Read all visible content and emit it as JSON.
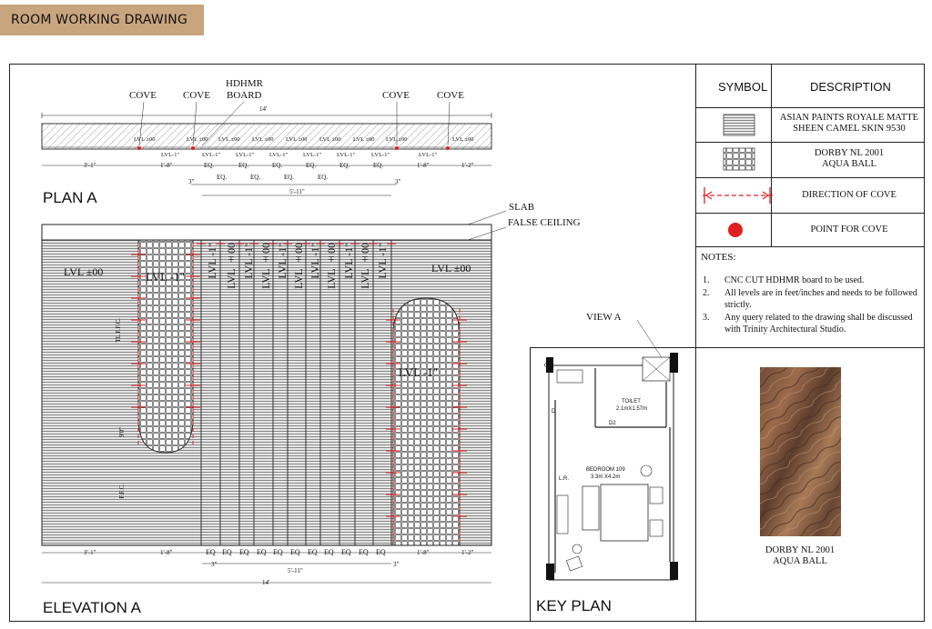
{
  "header": {
    "title": "ROOM WORKING DRAWING"
  },
  "plan": {
    "title": "PLAN A",
    "labels": {
      "cove": "COVE",
      "hdhmr_line1": "HDHMR",
      "hdhmr_line2": "BOARD"
    },
    "top_dim": "14'",
    "levels_top": [
      "LVL ±00",
      "LVL ±00",
      "LVL ±00",
      "LVL ±00",
      "LVL ±00",
      "LVL ±00",
      "LVL ±00",
      "LVL ±00",
      "LVL ±00"
    ],
    "levels_bottom": [
      "LVL-1\"",
      "LVL-1\"",
      "LVL-1\"",
      "LVL-1\"",
      "LVL-1\"",
      "LVL-1\"",
      "LVL-1\""
    ],
    "dims": [
      "3'-1\"",
      "1'-8\"",
      "EQ.",
      "EQ.",
      "EQ.",
      "EQ.",
      "EQ.",
      "EQ.",
      "1'-8\"",
      "1'-2\""
    ],
    "sub_dims": [
      "3\"",
      "EQ.",
      "EQ.",
      "EQ.",
      "EQ.",
      "3\""
    ],
    "span_dim": "5'-11\""
  },
  "elevation": {
    "title": "ELEVATION A",
    "slab": "SLAB",
    "false_ceiling": "FALSE CEILING",
    "lvl_left": "LVL ±00",
    "lvl_right": "LVL ±00",
    "lvl_pocket_left": "LVL -1\"",
    "lvl_pocket_right": "LVL -1\"",
    "strip_labels": [
      "LVL -1\"",
      "LVL ±00",
      "LVL -1\"",
      "LVL ±00",
      "LVL -1\"",
      "LVL ±00",
      "LVL -1\"",
      "LVL ±00",
      "LVL -1\"",
      "LVL ±00",
      "LVL -1\""
    ],
    "side_marks": [
      "TL F.F.C.",
      "9'0\"",
      "F.F.C."
    ],
    "dims": [
      "3'-1\"",
      "1'-8\"",
      "EQ",
      "EQ",
      "EQ",
      "EQ",
      "EQ",
      "EQ",
      "EQ",
      "EQ",
      "EQ",
      "EQ",
      "EQ",
      "1'-8\"",
      "1'-2\""
    ],
    "sub_dims": [
      "3\"",
      "5'-11\"",
      "3\""
    ],
    "total_dim": "14'"
  },
  "legend": {
    "symbol_header": "SYMBOL",
    "description_header": "DESCRIPTION",
    "rows": [
      {
        "symbol": "horizontal-hatch-swatch",
        "description_line1": "ASIAN PAINTS ROYALE MATTE",
        "description_line2": "SHEEN CAMEL SKIN 9530"
      },
      {
        "symbol": "grid-tile-swatch",
        "description_line1": "DORBY NL 2001",
        "description_line2": "AQUA BALL"
      },
      {
        "symbol": "direction-of-cove-arrow",
        "description_line1": "DIRECTION OF COVE",
        "description_line2": ""
      },
      {
        "symbol": "red-dot",
        "description_line1": "POINT FOR COVE",
        "description_line2": ""
      }
    ],
    "colors": {
      "cove_red": "#e02020",
      "sample_brown": "#8a5a3a"
    }
  },
  "notes": {
    "title": "NOTES:",
    "items": [
      {
        "num": "1.",
        "text": "CNC CUT HDHMR board to be used."
      },
      {
        "num": "2.",
        "text": "All levels are in feet/inches and needs to be followed strictly."
      },
      {
        "num": "3.",
        "text": "Any query related to the drawing shall be discussed with Trinity Architectural Studio."
      }
    ]
  },
  "key_plan": {
    "title": "KEY PLAN",
    "view": "VIEW A",
    "toilet": "TOILET",
    "toilet_size": "2.1mX1.57m",
    "bedroom": "BEDROOM 109",
    "bedroom_size": "3.3m X4.2m",
    "door_d": "D",
    "door_d2": "D2",
    "lr": "L.R.",
    "c": "C"
  },
  "material_sample": {
    "line1": "DORBY NL 2001",
    "line2": "AQUA BALL"
  }
}
